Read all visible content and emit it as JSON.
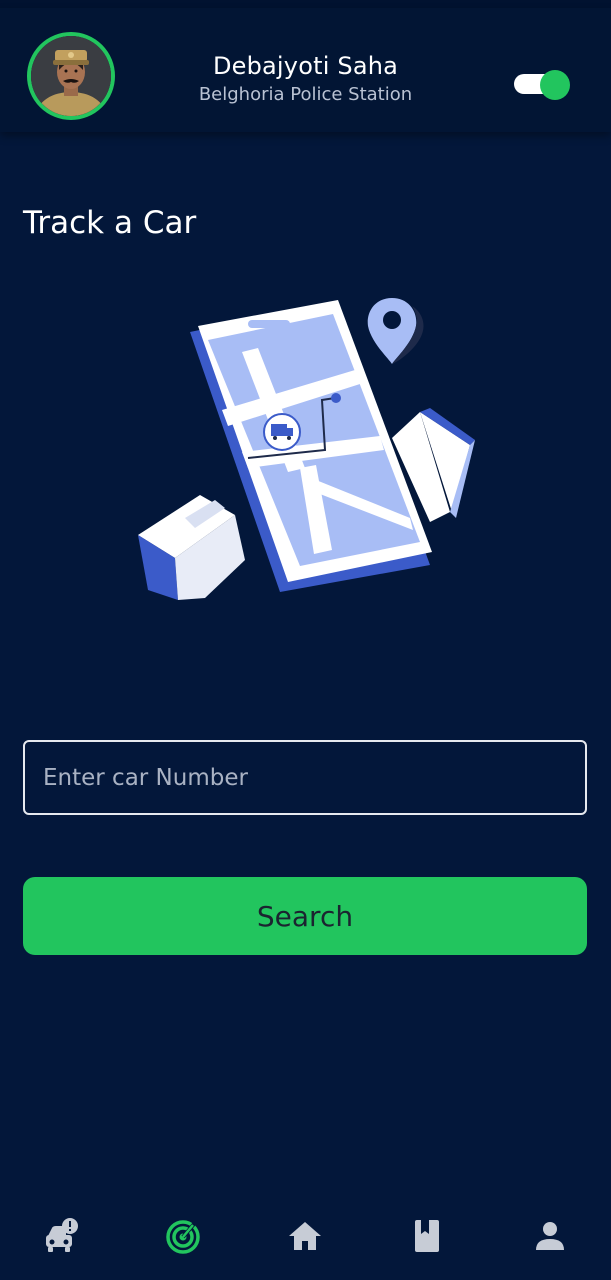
{
  "header": {
    "user_name": "Debajyoti Saha",
    "station": "Belghoria Police Station",
    "toggle_on": true
  },
  "main": {
    "title": "Track a Car",
    "car_input": {
      "placeholder": "Enter car Number",
      "value": ""
    },
    "search_label": "Search"
  },
  "bottom_nav": {
    "items": [
      {
        "icon": "car-alert-icon",
        "active": false
      },
      {
        "icon": "radar-icon",
        "active": true
      },
      {
        "icon": "home-icon",
        "active": false
      },
      {
        "icon": "bookmark-book-icon",
        "active": false
      },
      {
        "icon": "person-icon",
        "active": false
      }
    ]
  },
  "colors": {
    "background": "#03173a",
    "accent": "#22c55e",
    "inactive_icon": "#c7ccd6",
    "illustration_blue": "#3b5bc9",
    "illustration_light": "#a8bdf5"
  }
}
